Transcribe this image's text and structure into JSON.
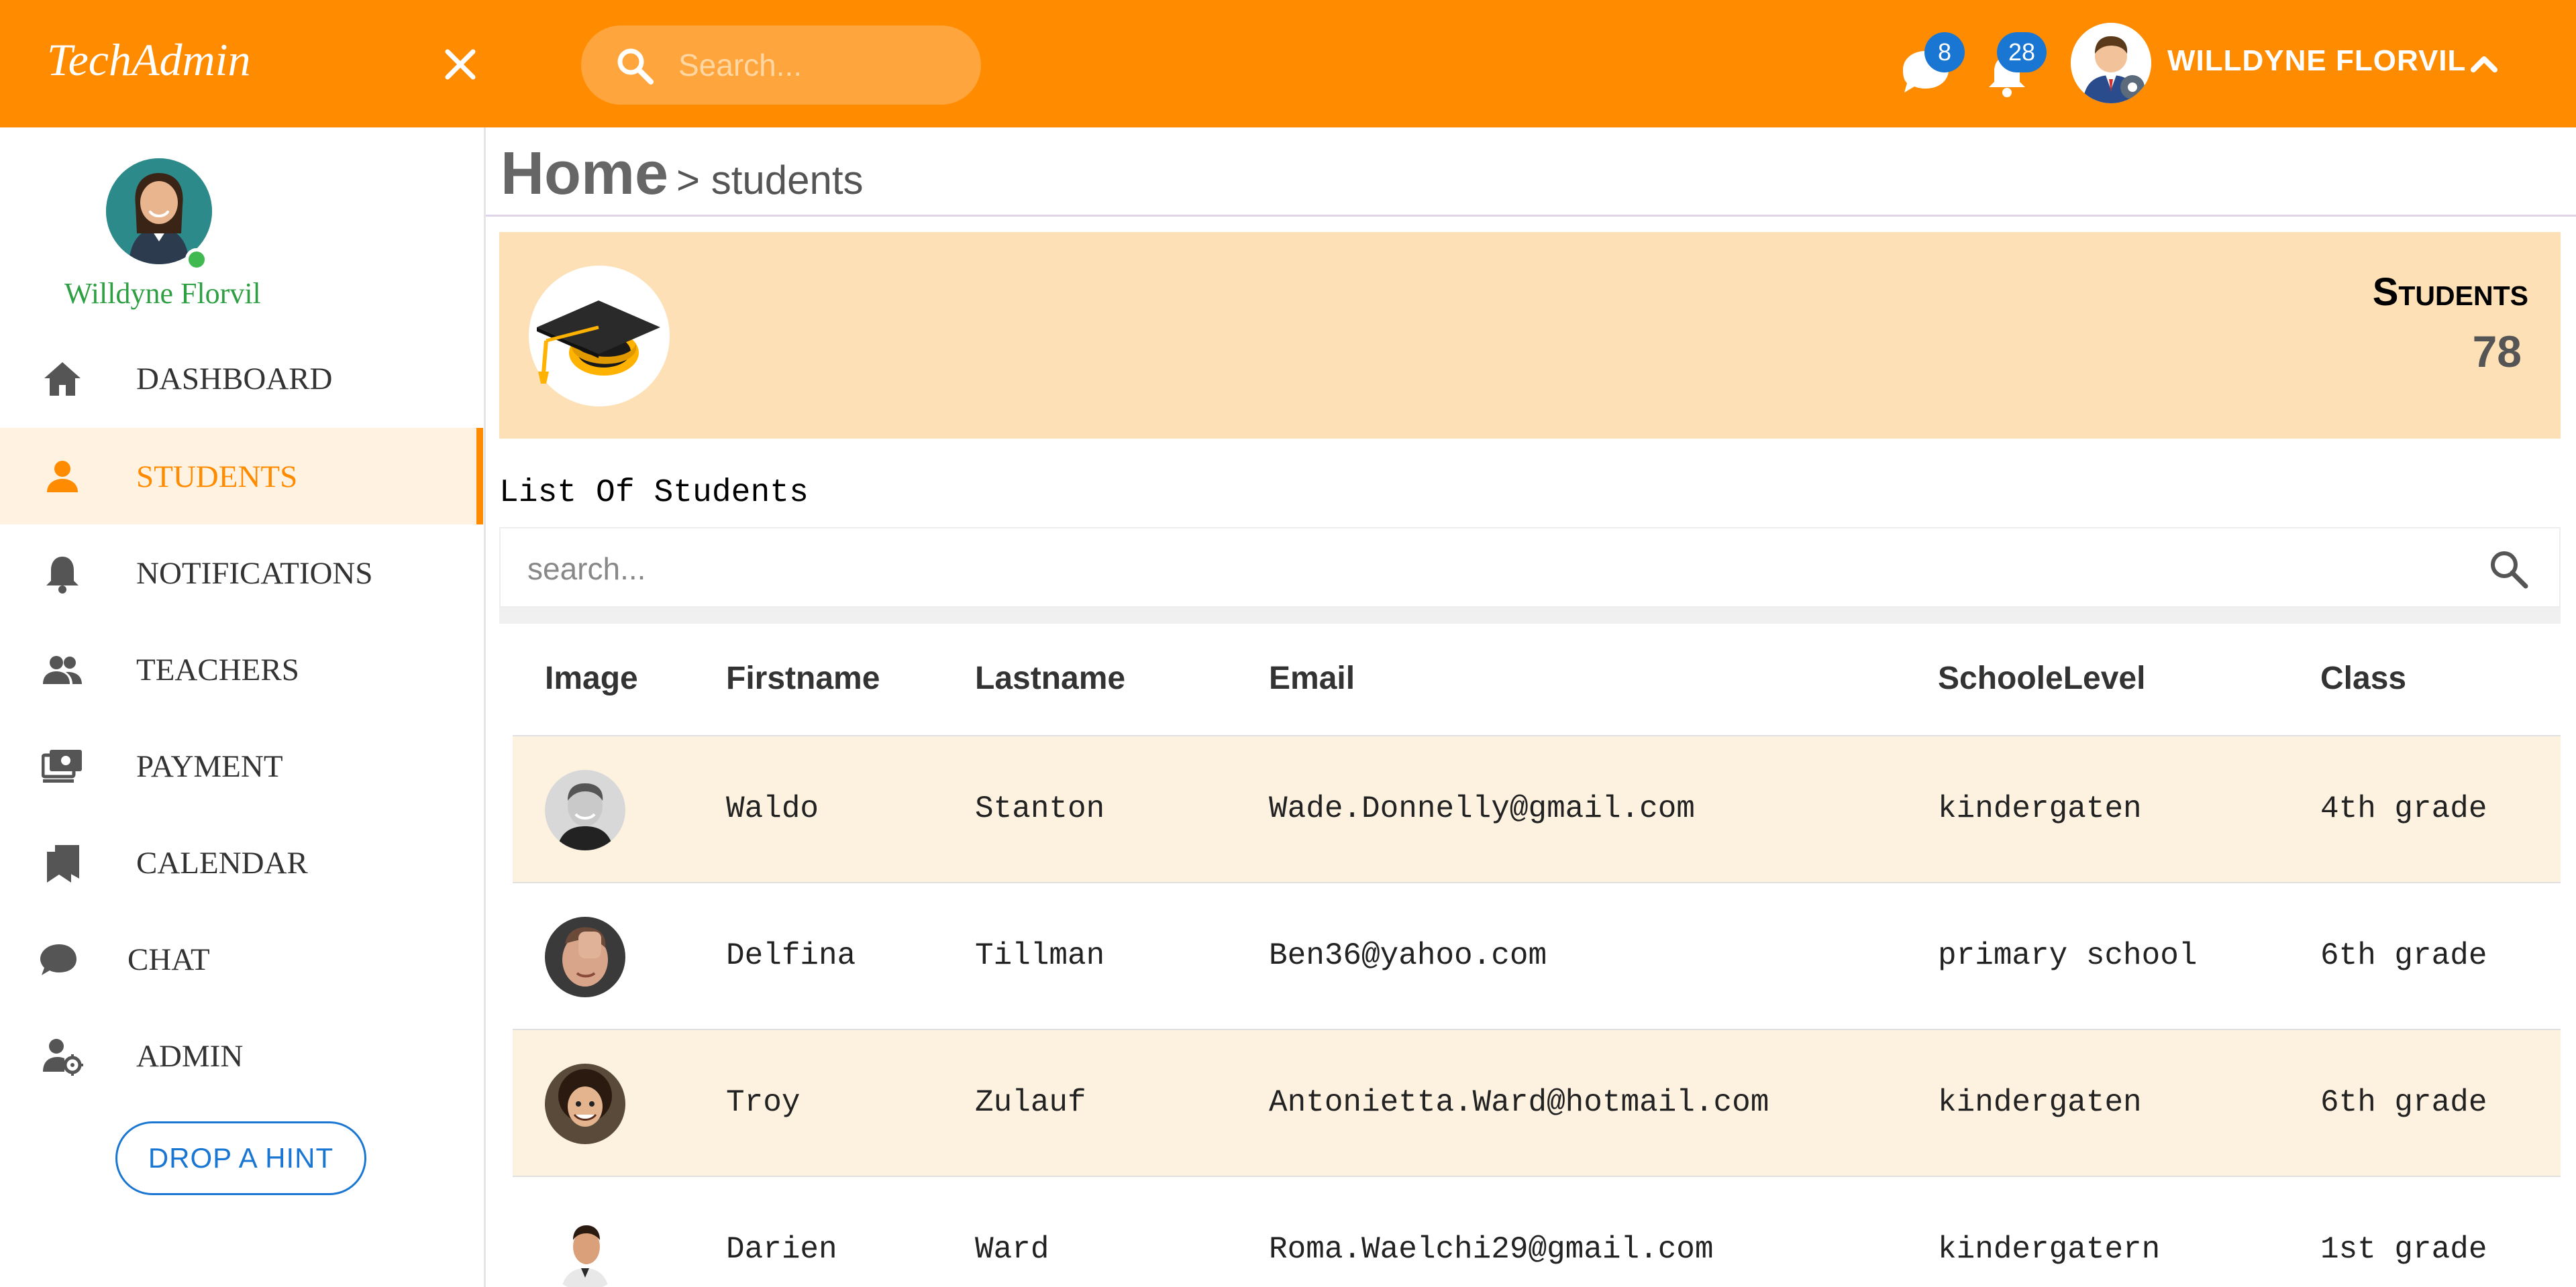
{
  "app": {
    "brand": "TechAdmin",
    "search_placeholder": "Search...",
    "messages_count": "8",
    "notifications_count": "28",
    "user_name": "WILLDYNE FLORVIL"
  },
  "sidebar": {
    "profile_name": "Willdyne Florvil",
    "items": [
      {
        "label": "DASHBOARD",
        "icon": "home-icon"
      },
      {
        "label": "STUDENTS",
        "icon": "person-icon",
        "active": true
      },
      {
        "label": "NOTIFICATIONS",
        "icon": "bell-icon"
      },
      {
        "label": "TEACHERS",
        "icon": "people-icon"
      },
      {
        "label": "PAYMENT",
        "icon": "payment-icon"
      },
      {
        "label": "CALENDAR",
        "icon": "bookmarks-icon"
      },
      {
        "label": "CHAT",
        "icon": "chat-bubble-icon"
      },
      {
        "label": "ADMIN",
        "icon": "admin-settings-icon"
      }
    ],
    "hint_button": "DROP A HINT"
  },
  "breadcrumb": {
    "home": "Home",
    "current": "> students"
  },
  "banner": {
    "title": "Students",
    "count": "78",
    "icon": "graduation-cap-icon"
  },
  "list": {
    "title": "List Of Students",
    "search_placeholder": "search...",
    "columns": [
      "Image",
      "Firstname",
      "Lastname",
      "Email",
      "SchooleLevel",
      "Class"
    ],
    "rows": [
      {
        "firstname": "Waldo",
        "lastname": "Stanton",
        "email": "Wade.Donnelly@gmail.com",
        "level": "kindergaten",
        "class": "4th grade"
      },
      {
        "firstname": "Delfina",
        "lastname": "Tillman",
        "email": "Ben36@yahoo.com",
        "level": "primary school",
        "class": "6th grade"
      },
      {
        "firstname": "Troy",
        "lastname": "Zulauf",
        "email": "Antonietta.Ward@hotmail.com",
        "level": "kindergaten",
        "class": "6th grade"
      },
      {
        "firstname": "Darien",
        "lastname": "Ward",
        "email": "Roma.Waelchi29@gmail.com",
        "level": "kindergatern",
        "class": "1st grade"
      }
    ]
  },
  "colors": {
    "accent": "#ff8c00",
    "banner": "#fde0b5",
    "row_highlight": "#fdf2e0",
    "badge": "#1976d2",
    "online": "#3fb950"
  }
}
